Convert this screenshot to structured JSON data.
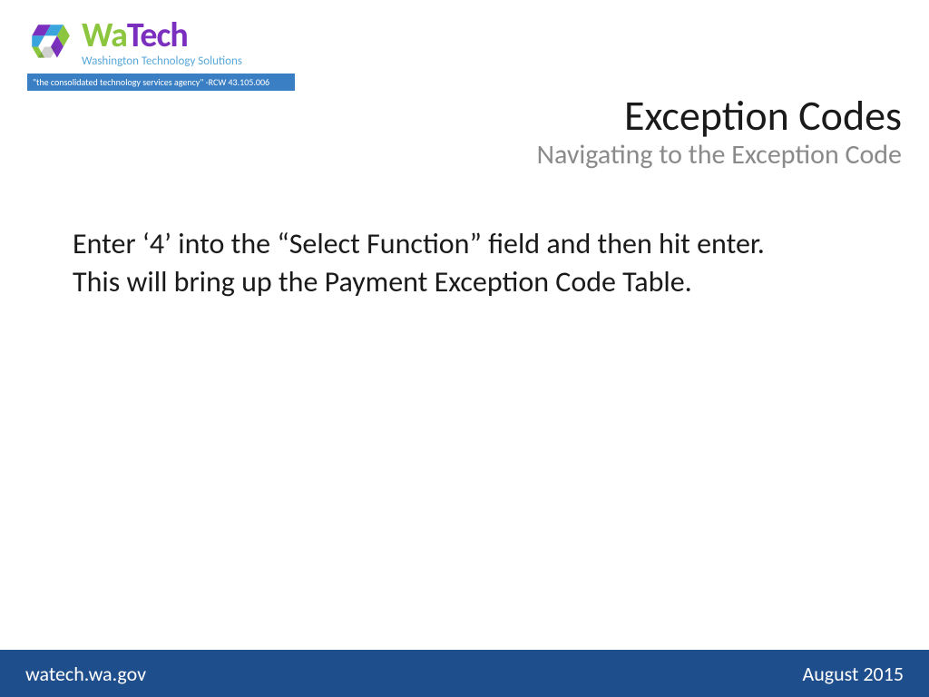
{
  "logo": {
    "name_wa": "Wa",
    "name_tech": "Tech",
    "tagline": "Washington Technology Solutions",
    "banner": "\"the consolidated technology services agency\" -RCW 43.105.006"
  },
  "header": {
    "title": "Exception Codes",
    "subtitle": "Navigating to the Exception Code"
  },
  "body": {
    "paragraph": "Enter ‘4’ into the “Select Function” field and then hit enter.  This will bring up the Payment Exception Code Table."
  },
  "footer": {
    "left": "watech.wa.gov",
    "right": "August 2015"
  }
}
